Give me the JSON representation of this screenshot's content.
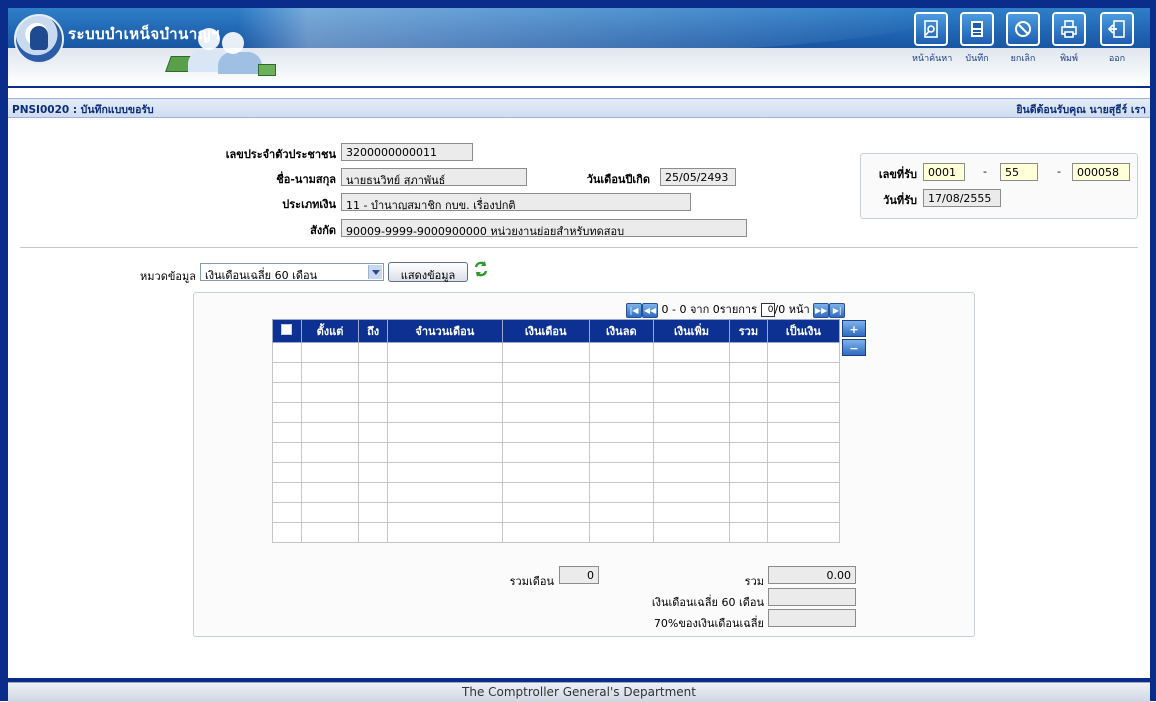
{
  "app": {
    "title": "ระบบบำเหน็จบำนาญฯ"
  },
  "toolbar": [
    {
      "label": "หน้าค้นหา",
      "icon": "search-page-icon"
    },
    {
      "label": "บันทึก",
      "icon": "save-icon"
    },
    {
      "label": "ยกเลิก",
      "icon": "cancel-icon"
    },
    {
      "label": "พิมพ์",
      "icon": "print-icon"
    },
    {
      "label": "ออก",
      "icon": "exit-icon"
    }
  ],
  "page": {
    "code_title": "PNSI0020 : บันทึกแบบขอรับ",
    "welcome": "ยินดีต้อนรับคุณ นายสุธีร์ เรา"
  },
  "form": {
    "id_label": "เลขประจำตัวประชาชน",
    "id_value": "3200000000011",
    "name_label": "ชื่อ-นามสกุล",
    "name_value": "นายธนวิทย์ สุภาพันธ์",
    "dob_label": "วันเดือนปีเกิด",
    "dob_value": "25/05/2493",
    "type_label": "ประเภทเงิน",
    "type_value": "11 - บำนาญสมาชิก กบข.  เรื่องปกติ",
    "dept_label": "สังกัด",
    "dept_value": "90009-9999-9000900000  หน่วยงานย่อยสำหรับทดสอบ"
  },
  "receipt": {
    "no_label": "เลขที่รับ",
    "no_part1": "0001",
    "dash1": "-",
    "no_part2": "55",
    "dash2": "-",
    "no_part3": "000058",
    "date_label": "วันที่รับ",
    "date_value": "17/08/2555"
  },
  "filter": {
    "category_label": "หมวดข้อมูล",
    "category_value": "เงินเดือนเฉลี่ย 60 เดือน",
    "show_button": "แสดงข้อมูล"
  },
  "pager": {
    "text_before": "0 - 0 จาก 0รายการ",
    "page_value": "0",
    "text_after": "/0 หน้า"
  },
  "table": {
    "columns": [
      "",
      "ตั้งแต่",
      "ถึง",
      "จำนวนเดือน",
      "เงินเดือน",
      "เงินลด",
      "เงินเพิ่ม",
      "รวม",
      "เป็นเงิน"
    ],
    "rows": 10
  },
  "summary": {
    "months_label": "รวมเดือน",
    "months_value": "0",
    "total_label": "รวม",
    "total_value": "0.00",
    "avg_label": "เงินเดือนเฉลี่ย 60 เดือน",
    "avg_value": "",
    "pct_label": "70%ของเงินเดือนเฉลี่ย",
    "pct_value": ""
  },
  "footer": {
    "text": "The Comptroller General's Department"
  }
}
